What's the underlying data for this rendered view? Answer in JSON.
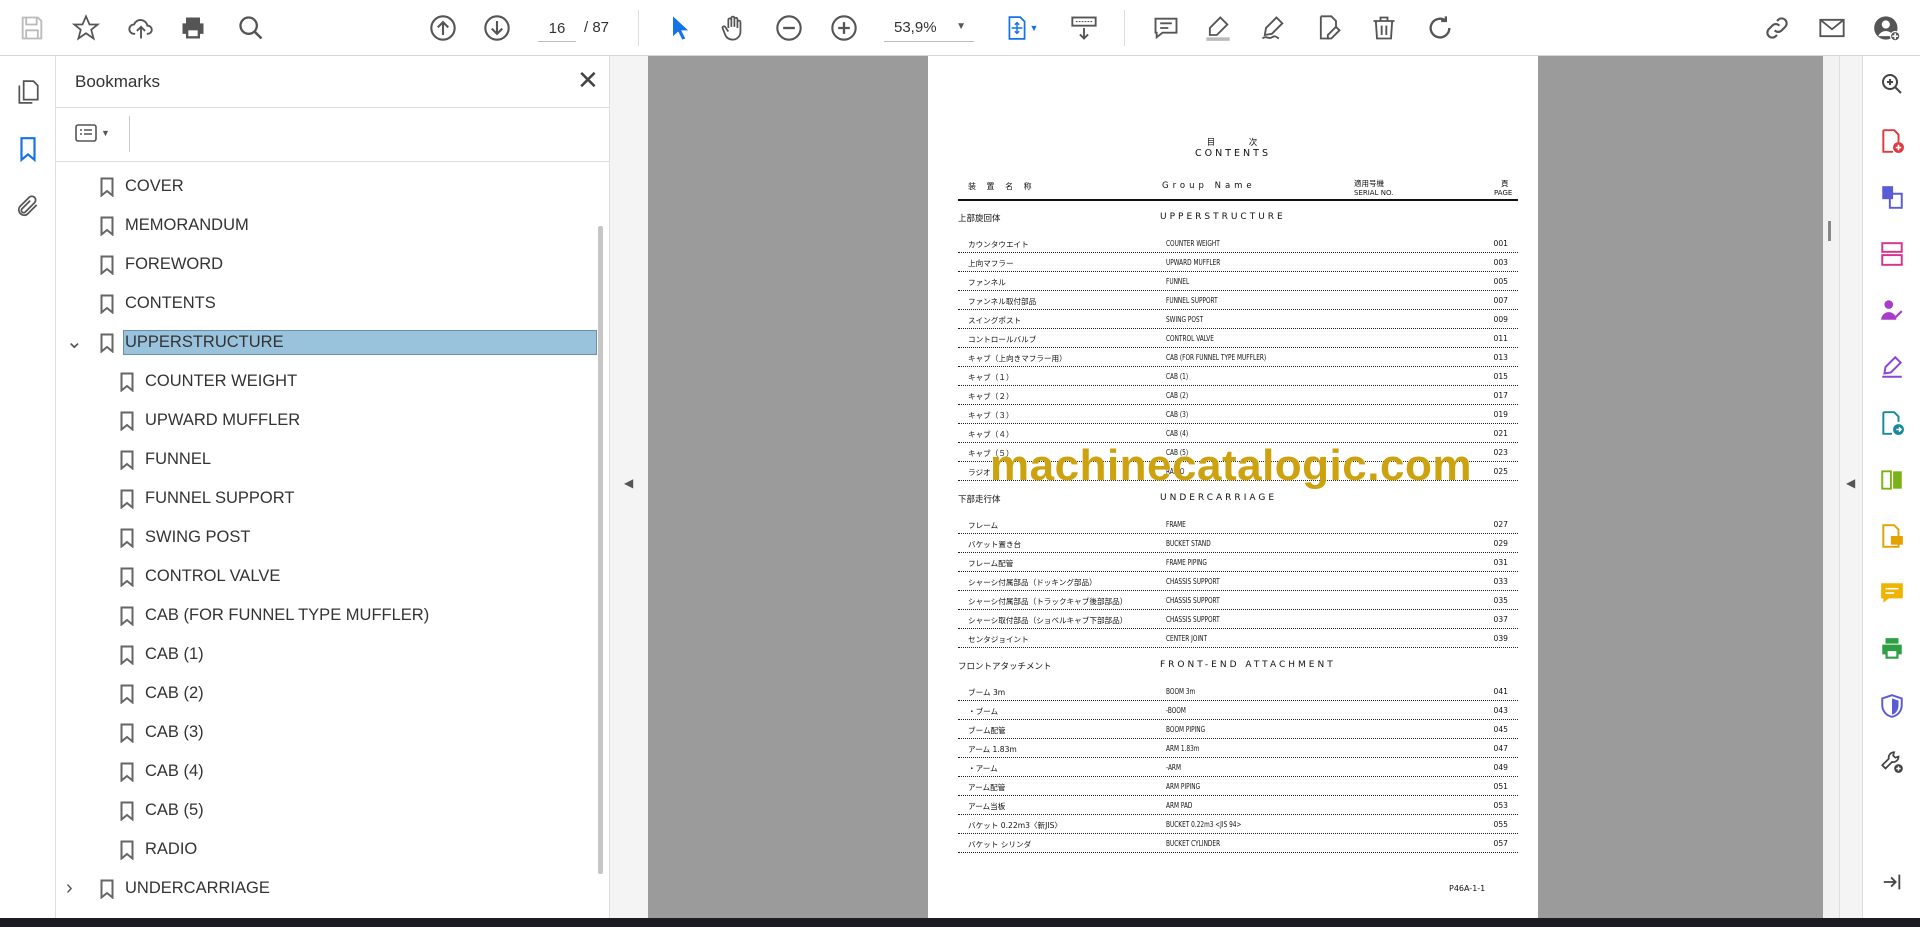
{
  "toolbar": {
    "page_current": "16",
    "page_total": "/ 87",
    "zoom": "53,9%"
  },
  "bookmarks": {
    "title": "Bookmarks",
    "items": [
      {
        "label": "COVER",
        "level": 0
      },
      {
        "label": "MEMORANDUM",
        "level": 0
      },
      {
        "label": "FOREWORD",
        "level": 0
      },
      {
        "label": "CONTENTS",
        "level": 0
      },
      {
        "label": "UPPERSTRUCTURE",
        "level": 0,
        "expanded": true,
        "selected": true
      },
      {
        "label": "COUNTER WEIGHT",
        "level": 1
      },
      {
        "label": "UPWARD MUFFLER",
        "level": 1
      },
      {
        "label": "FUNNEL",
        "level": 1
      },
      {
        "label": "FUNNEL SUPPORT",
        "level": 1
      },
      {
        "label": "SWING POST",
        "level": 1
      },
      {
        "label": "CONTROL VALVE",
        "level": 1
      },
      {
        "label": "CAB (FOR FUNNEL TYPE MUFFLER)",
        "level": 1
      },
      {
        "label": "CAB (1)",
        "level": 1
      },
      {
        "label": "CAB (2)",
        "level": 1
      },
      {
        "label": "CAB (3)",
        "level": 1
      },
      {
        "label": "CAB (4)",
        "level": 1
      },
      {
        "label": "CAB (5)",
        "level": 1
      },
      {
        "label": "RADIO",
        "level": 1
      },
      {
        "label": "UNDERCARRIAGE",
        "level": 0,
        "expanded": false
      }
    ]
  },
  "document": {
    "title_jp": "目　　　次",
    "title": "CONTENTS",
    "col_jp": "装 置 名 称",
    "col_group": "Group Name",
    "col_serial_jp": "適用号機",
    "col_serial": "SERIAL NO.",
    "col_page_jp": "頁",
    "col_page": "PAGE",
    "sections": [
      {
        "jp": "上部旋回体",
        "en": "UPPERSTRUCTURE",
        "rows": [
          [
            "カウンタウエイト",
            "COUNTER WEIGHT",
            "001"
          ],
          [
            "上向マフラー",
            "UPWARD MUFFLER",
            "003"
          ],
          [
            "ファンネル",
            "FUNNEL",
            "005"
          ],
          [
            "ファンネル取付部品",
            "FUNNEL SUPPORT",
            "007"
          ],
          [
            "スイングポスト",
            "SWING POST",
            "009"
          ],
          [
            "コントロールバルブ",
            "CONTROL VALVE",
            "011"
          ],
          [
            "キャブ（上向きマフラー用）",
            "CAB (FOR FUNNEL TYPE MUFFLER)",
            "013"
          ],
          [
            "キャブ（１）",
            "CAB (1)",
            "015"
          ],
          [
            "キャブ（２）",
            "CAB (2)",
            "017"
          ],
          [
            "キャブ（３）",
            "CAB (3)",
            "019"
          ],
          [
            "キャブ（４）",
            "CAB (4)",
            "021"
          ],
          [
            "キャブ（５）",
            "CAB (5)",
            "023"
          ],
          [
            "ラジオ",
            "RADIO",
            "025"
          ]
        ]
      },
      {
        "jp": "下部走行体",
        "en": "UNDERCARRIAGE",
        "rows": [
          [
            "フレーム",
            "FRAME",
            "027"
          ],
          [
            "バケット置き台",
            "BUCKET STAND",
            "029"
          ],
          [
            "フレーム配管",
            "FRAME PIPING",
            "031"
          ],
          [
            "シャーシ付属部品（ドッキング部品）",
            "CHASSIS SUPPORT",
            "033"
          ],
          [
            "シャーシ付属部品（トラックキャブ後部部品）",
            "CHASSIS SUPPORT",
            "035"
          ],
          [
            "シャーシ取付部品（ショベルキャブ下部部品）",
            "CHASSIS SUPPORT",
            "037"
          ],
          [
            "センタジョイント",
            "CENTER JOINT",
            "039"
          ]
        ]
      },
      {
        "jp": "フロントアタッチメント",
        "en": "FRONT-END ATTACHMENT",
        "rows": [
          [
            "ブーム 3m",
            "BOOM 3m",
            "041"
          ],
          [
            "・ブーム",
            "-BOOM",
            "043"
          ],
          [
            "ブーム配管",
            "BOOM PIPING",
            "045"
          ],
          [
            "アーム 1.83m",
            "ARM 1.83m",
            "047"
          ],
          [
            "・アーム",
            "-ARM",
            "049"
          ],
          [
            "アーム配管",
            "ARM PIPING",
            "051"
          ],
          [
            "アーム当板",
            "ARM PAD",
            "053"
          ],
          [
            "バケット 0.22m3〈新JIS〉",
            "BUCKET 0.22m3 <JIS 94>",
            "055"
          ],
          [
            "バケット シリンダ",
            "BUCKET CYLINDER",
            "057"
          ]
        ]
      }
    ],
    "footer": "P46A-1-1",
    "watermark": "machinecatalogic.com"
  },
  "colors": {
    "accent": "#1473e6",
    "selection": "#99c2dc",
    "viewer_bg": "#9b9b9b",
    "watermark": "#cda20f"
  }
}
